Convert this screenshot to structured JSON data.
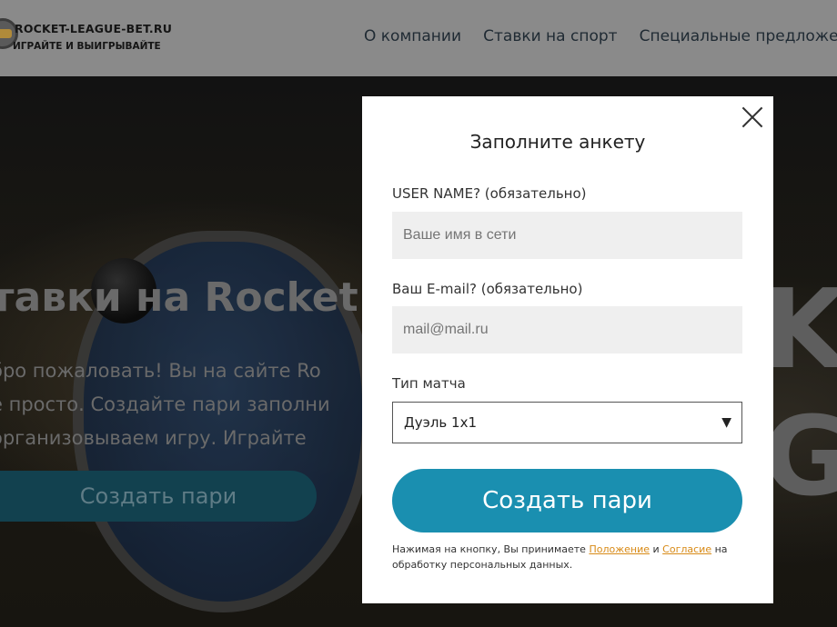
{
  "header": {
    "logo_title": "ROCKET-LEAGUE-BET.RU",
    "logo_subtitle": "ИГРАЙТЕ И ВЫИГРЫВАЙТЕ",
    "nav": [
      {
        "label": "О компании"
      },
      {
        "label": "Ставки на спорт"
      },
      {
        "label": "Специальные предложения"
      }
    ]
  },
  "hero": {
    "title": "тавки на Rocket",
    "lines": [
      "бро пожаловать! Вы на сайте Ro",
      "е просто. Создайте пари заполни",
      "организовываем игру. Играйте"
    ],
    "button_label": "Создать пари",
    "bg_letters": "K G"
  },
  "modal": {
    "title": "Заполните анкету",
    "username": {
      "label": "USER NAME? (обязательно)",
      "placeholder": "Ваше имя в сети",
      "value": ""
    },
    "email": {
      "label": "Ваш E-mail? (обязательно)",
      "placeholder": "mail@mail.ru",
      "value": ""
    },
    "match_type": {
      "label": "Тип матча",
      "selected": "Дуэль 1x1",
      "arrow": "▼"
    },
    "submit_label": "Создать пари",
    "consent": {
      "prefix": "Нажимая на кнопку, Вы принимаете",
      "link1": "Положение",
      "middle": "и",
      "link2": "Согласие",
      "suffix": "на обработку персональных данных."
    }
  },
  "colors": {
    "accent": "#1a8fb0",
    "link": "#d88a16",
    "header_bg": "#8a8a8a",
    "hero_button": "#12414f"
  }
}
